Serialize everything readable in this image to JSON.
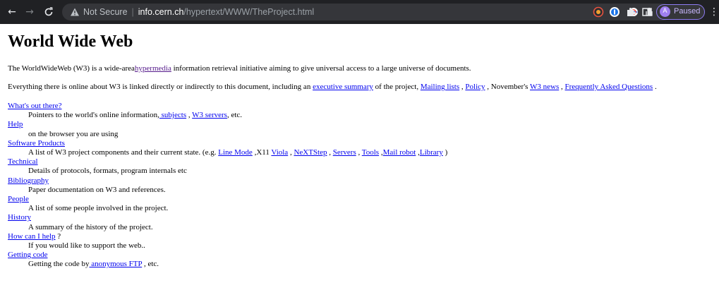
{
  "browser": {
    "security_label": "Not Secure",
    "url_host": "info.cern.ch",
    "url_path": "/hypertext/WWW/TheProject.html",
    "profile_initial": "A",
    "profile_status": "Paused",
    "accent_color": "#8f7cf4"
  },
  "page": {
    "title": "World Wide Web",
    "intro": {
      "before": "The WorldWideWeb (W3) is a wide-area",
      "link": "hypermedia",
      "after": " information retrieval initiative aiming to give universal access to a large universe of documents."
    },
    "everything": {
      "text1": "Everything there is online about W3 is linked directly or indirectly to this document, including an ",
      "link1": "executive summary",
      "text2": " of the project, ",
      "link2": "Mailing lists",
      "text3": " , ",
      "link3": "Policy",
      "text4": " , November's ",
      "link4": "W3 news",
      "text5": " , ",
      "link5": "Frequently Asked Questions",
      "text6": " ."
    },
    "entries": [
      {
        "term": "What's out there?",
        "desc_before": "Pointers to the world's online information,",
        "desc_link1": " subjects",
        "desc_mid": " , ",
        "desc_link2": "W3 servers",
        "desc_after": ", etc."
      },
      {
        "term": "Help",
        "desc": "on the browser you are using"
      },
      {
        "term": "Software Products",
        "desc_before": "A list of W3 project components and their current state. (e.g. ",
        "links": [
          {
            "text": "Line Mode",
            "sep_after": " ,X11 "
          },
          {
            "text": "Viola",
            "sep_after": " , "
          },
          {
            "text": "NeXTStep",
            "sep_after": " , "
          },
          {
            "text": "Servers",
            "sep_after": " , "
          },
          {
            "text": "Tools",
            "sep_after": " ,"
          },
          {
            "text": "Mail robot",
            "sep_after": " ,"
          },
          {
            "text": "Library",
            "sep_after": " )"
          }
        ]
      },
      {
        "term": "Technical",
        "desc": "Details of protocols, formats, program internals etc"
      },
      {
        "term": "Bibliography",
        "desc": "Paper documentation on W3 and references."
      },
      {
        "term": "People",
        "desc": "A list of some people involved in the project."
      },
      {
        "term": "History",
        "desc": "A summary of the history of the project."
      },
      {
        "term": "How can I help",
        "term_suffix": " ?",
        "desc": "If you would like to support the web.."
      },
      {
        "term": "Getting code",
        "desc_before": "Getting the code by",
        "desc_link1": " anonymous FTP",
        "desc_after": " , etc."
      }
    ]
  }
}
